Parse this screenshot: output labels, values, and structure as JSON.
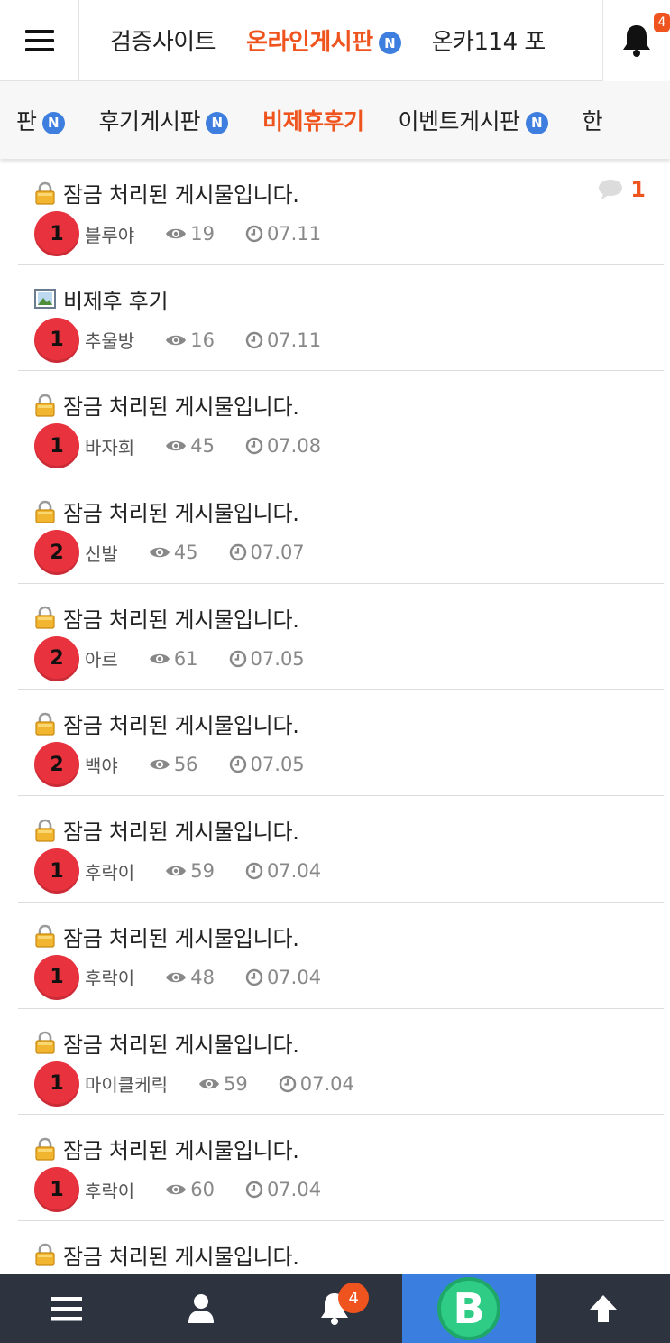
{
  "top_nav": {
    "items": [
      {
        "label": "검증사이트",
        "badge": ""
      },
      {
        "label": "온라인게시판",
        "badge": "N"
      },
      {
        "label": "온카114 포",
        "badge": ""
      }
    ],
    "notification_count": "4"
  },
  "sub_nav": {
    "items": [
      {
        "label": "판",
        "badge": "N"
      },
      {
        "label": "후기게시판",
        "badge": "N"
      },
      {
        "label": "비제휴후기",
        "badge": ""
      },
      {
        "label": "이벤트게시판",
        "badge": "N"
      },
      {
        "label": "한",
        "badge": ""
      }
    ]
  },
  "posts": [
    {
      "icon": "lock-icon",
      "title": "잠금 처리된 게시물입니다.",
      "level": "1",
      "author": "블루야",
      "views": "19",
      "date": "07.11",
      "comments": "1"
    },
    {
      "icon": "image-icon",
      "title": "비제후 후기",
      "level": "1",
      "author": "추울방",
      "views": "16",
      "date": "07.11",
      "comments": ""
    },
    {
      "icon": "lock-icon",
      "title": "잠금 처리된 게시물입니다.",
      "level": "1",
      "author": "바자회",
      "views": "45",
      "date": "07.08",
      "comments": ""
    },
    {
      "icon": "lock-icon",
      "title": "잠금 처리된 게시물입니다.",
      "level": "2",
      "author": "신발",
      "views": "45",
      "date": "07.07",
      "comments": ""
    },
    {
      "icon": "lock-icon",
      "title": "잠금 처리된 게시물입니다.",
      "level": "2",
      "author": "아르",
      "views": "61",
      "date": "07.05",
      "comments": ""
    },
    {
      "icon": "lock-icon",
      "title": "잠금 처리된 게시물입니다.",
      "level": "2",
      "author": "백야",
      "views": "56",
      "date": "07.05",
      "comments": ""
    },
    {
      "icon": "lock-icon",
      "title": "잠금 처리된 게시물입니다.",
      "level": "1",
      "author": "후락이",
      "views": "59",
      "date": "07.04",
      "comments": ""
    },
    {
      "icon": "lock-icon",
      "title": "잠금 처리된 게시물입니다.",
      "level": "1",
      "author": "후락이",
      "views": "48",
      "date": "07.04",
      "comments": ""
    },
    {
      "icon": "lock-icon",
      "title": "잠금 처리된 게시물입니다.",
      "level": "1",
      "author": "마이클케릭",
      "views": "59",
      "date": "07.04",
      "comments": ""
    },
    {
      "icon": "lock-icon",
      "title": "잠금 처리된 게시물입니다.",
      "level": "1",
      "author": "후락이",
      "views": "60",
      "date": "07.04",
      "comments": ""
    },
    {
      "icon": "lock-icon",
      "title": "잠금 처리된 게시물입니다.",
      "level": "",
      "author": "",
      "views": "",
      "date": "",
      "comments": ""
    }
  ],
  "bottom_bar": {
    "notification_count": "4",
    "brand_letter": "B"
  },
  "colors": {
    "accent": "#f0541e",
    "badge_blue": "#3e7ede",
    "level_red": "#e8323e",
    "bottom_bar": "#2e3340",
    "brand_blue": "#3a7ee0"
  }
}
